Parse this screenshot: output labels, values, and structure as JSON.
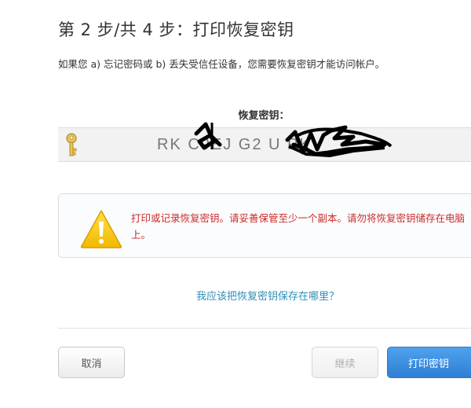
{
  "step": {
    "title": "第 2 步/共 4 步：打印恢复密钥",
    "description": "如果您 a) 忘记密码或 b) 丢失受信任设备，您需要恢复密钥才能访问帐户。"
  },
  "recovery_key": {
    "label": "恢复密钥：",
    "value_partial": "RK  C9EJ  G2       U     PK",
    "icon": "key-icon"
  },
  "warning": {
    "icon": "warning-triangle-icon",
    "text": "打印或记录恢复密钥。请妥善保管至少一个副本。请勿将恢复密钥储存在电脑上。",
    "color": "#cc2a2a"
  },
  "help": {
    "link_text": "我应该把恢复密钥保存在哪里？"
  },
  "buttons": {
    "cancel": "取消",
    "continue": "继续",
    "print": "打印密钥"
  },
  "colors": {
    "accent": "#2f7fd6",
    "link": "#2d8fb8"
  }
}
